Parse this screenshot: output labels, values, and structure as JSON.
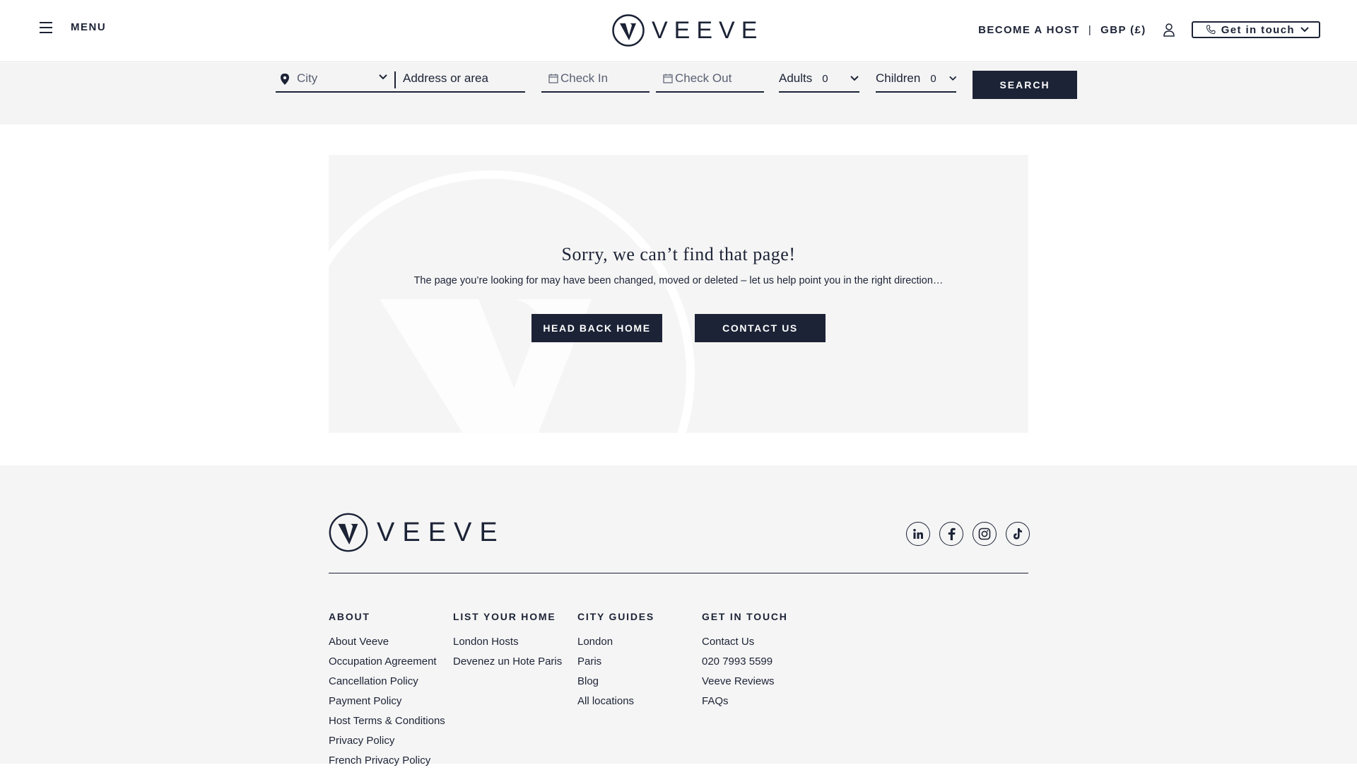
{
  "header": {
    "menu_label": "MENU",
    "logo_text": "VEEVE",
    "become_host": "BECOME A HOST",
    "separator": "|",
    "currency": "GBP (£)",
    "get_in_touch": "Get in touch"
  },
  "search": {
    "city_label": "City",
    "address_placeholder": "Address or area",
    "check_in": "Check In",
    "check_out": "Check Out",
    "adults_label": "Adults",
    "adults_value": "0",
    "children_label": "Children",
    "children_value": "0",
    "search_button": "SEARCH"
  },
  "error": {
    "title": "Sorry, we can’t find that page!",
    "message": "The page you’re looking for may have been changed, moved or deleted – let us help point you in the right direction…",
    "home_button": "HEAD BACK HOME",
    "contact_button": "CONTACT US"
  },
  "footer": {
    "logo_text": "VEEVE",
    "socials": [
      "linkedin-icon",
      "facebook-icon",
      "instagram-icon",
      "tiktok-icon"
    ],
    "columns": [
      {
        "heading": "ABOUT",
        "links": [
          "About Veeve",
          "Occupation Agreement",
          "Cancellation Policy",
          "Payment Policy",
          "Host Terms & Conditions",
          "Privacy Policy",
          "French Privacy Policy"
        ]
      },
      {
        "heading": "LIST YOUR HOME",
        "links": [
          "London Hosts",
          "Devenez un Hote Paris"
        ]
      },
      {
        "heading": "CITY GUIDES",
        "links": [
          "London",
          "Paris",
          "Blog",
          "All locations"
        ]
      },
      {
        "heading": "GET IN TOUCH",
        "links": [
          "Contact Us",
          "020 7993 5599",
          "Veeve Reviews",
          "FAQs"
        ]
      }
    ]
  },
  "colors": {
    "navy": "#1c2336",
    "light_bg": "#f5f5f5",
    "white": "#ffffff"
  }
}
